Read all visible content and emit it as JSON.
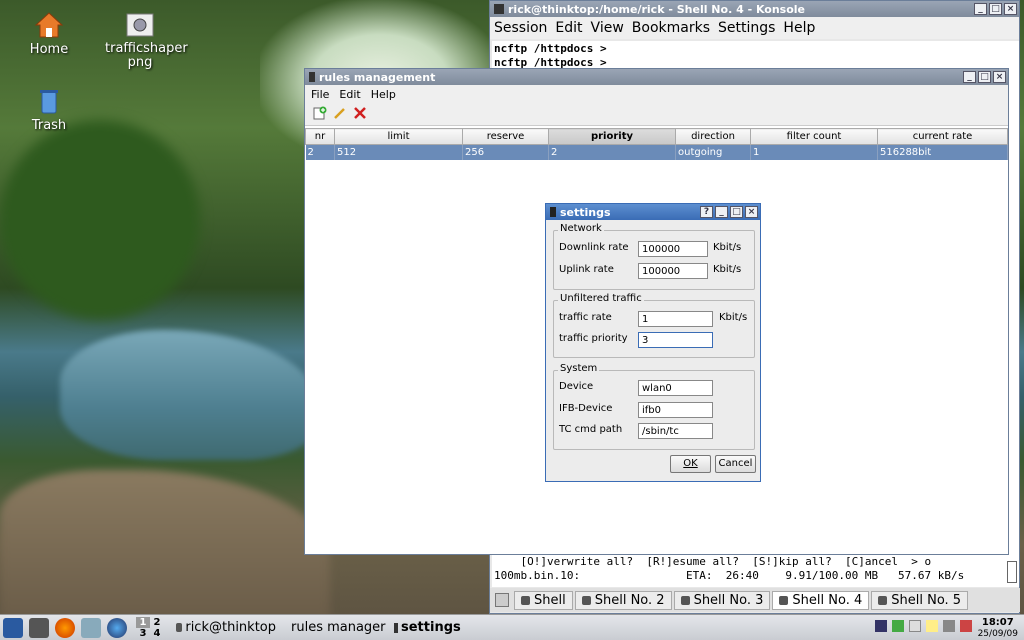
{
  "desktop": {
    "icons": [
      {
        "label": "Home"
      },
      {
        "label": "trafficshaper png"
      },
      {
        "label": "Trash"
      }
    ]
  },
  "konsole": {
    "title": "rick@thinktop:/home/rick - Shell No. 4 - Konsole",
    "menu": [
      "Session",
      "Edit",
      "View",
      "Bookmarks",
      "Settings",
      "Help"
    ],
    "lines_top": [
      "ncftp /httpdocs >",
      "ncftp /httpdocs >"
    ],
    "lines_bottom": [
      "    [O!]verwrite all?  [R!]esume all?  [S!]kip all?  [C]ancel  > o",
      "100mb.bin.10:                ETA:  26:40    9.91/100.00 MB   57.67 kB/s"
    ],
    "tabs": [
      "Shell",
      "Shell No. 2",
      "Shell No. 3",
      "Shell No. 4",
      "Shell No. 5"
    ]
  },
  "rules": {
    "title": "rules management",
    "menu": [
      "File",
      "Edit",
      "Help"
    ],
    "columns": [
      "nr",
      "limit",
      "reserve",
      "priority",
      "direction",
      "filter count",
      "current rate"
    ],
    "rows": [
      [
        "2",
        "512",
        "256",
        "2",
        "outgoing",
        "1",
        "516288bit"
      ]
    ]
  },
  "settings": {
    "title": "settings",
    "network": {
      "label": "Network",
      "downlink_label": "Downlink rate",
      "downlink_value": "100000",
      "downlink_unit": "Kbit/s",
      "uplink_label": "Uplink rate",
      "uplink_value": "100000",
      "uplink_unit": "Kbit/s"
    },
    "unfiltered": {
      "label": "Unfiltered traffic",
      "rate_label": "traffic rate",
      "rate_value": "1",
      "rate_unit": "Kbit/s",
      "priority_label": "traffic priority",
      "priority_value": "3"
    },
    "system": {
      "label": "System",
      "device_label": "Device",
      "device_value": "wlan0",
      "ifb_label": "IFB-Device",
      "ifb_value": "ifb0",
      "tc_label": "TC cmd path",
      "tc_value": "/sbin/tc"
    },
    "ok": "OK",
    "cancel": "Cancel"
  },
  "taskbar": {
    "pager": [
      "1",
      "2",
      "3",
      "4"
    ],
    "tasks": [
      "rick@thinktop",
      "rules manager",
      "settings"
    ],
    "time": "18:07",
    "date": "25/09/09"
  },
  "colors": {
    "accent": "#3a6cb5",
    "selection": "#6a8bb8"
  }
}
